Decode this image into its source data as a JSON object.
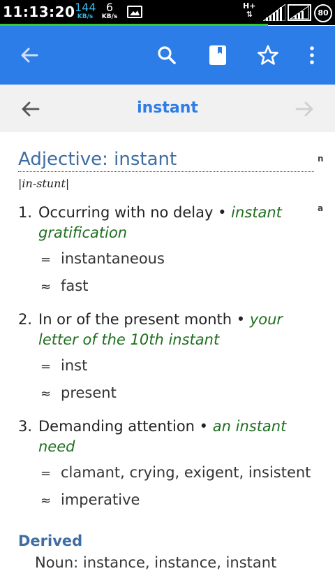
{
  "status_bar": {
    "time": "11:13:20",
    "upload_speed": "144",
    "upload_unit": "KB/s",
    "download_speed": "6",
    "download_unit": "KB/s",
    "network_type": "H+",
    "battery": "80",
    "accent_color": "#33b5e5",
    "progress_color": "#33cc33"
  },
  "app_bar": {
    "color": "#2d7de8",
    "icons": [
      "back-arrow-icon",
      "search-icon",
      "bookmark-icon",
      "star-icon",
      "more-vert-icon"
    ]
  },
  "title_bar": {
    "title": "instant",
    "title_color": "#2d7de8"
  },
  "entry": {
    "heading": "Adjective: instant",
    "side_marker_n": "n",
    "side_marker_a": "a",
    "pronunciation": "|in-stunt|",
    "senses": [
      {
        "number": "1.",
        "definition": "Occurring with no delay",
        "example": "instant gratification",
        "synonyms": "instantaneous",
        "similar": "fast"
      },
      {
        "number": "2.",
        "definition": "In or of the present month",
        "example": "your letter of the 10th instant",
        "synonyms": "inst",
        "similar": "present"
      },
      {
        "number": "3.",
        "definition": "Demanding attention",
        "example": "an instant need",
        "synonyms": "clamant, crying, exigent, insistent",
        "similar": "imperative"
      }
    ],
    "synonym_symbol": "=",
    "similar_symbol": "≈",
    "derived_label": "Derived",
    "derived_partial": "Noun: instance, instance, instant"
  }
}
